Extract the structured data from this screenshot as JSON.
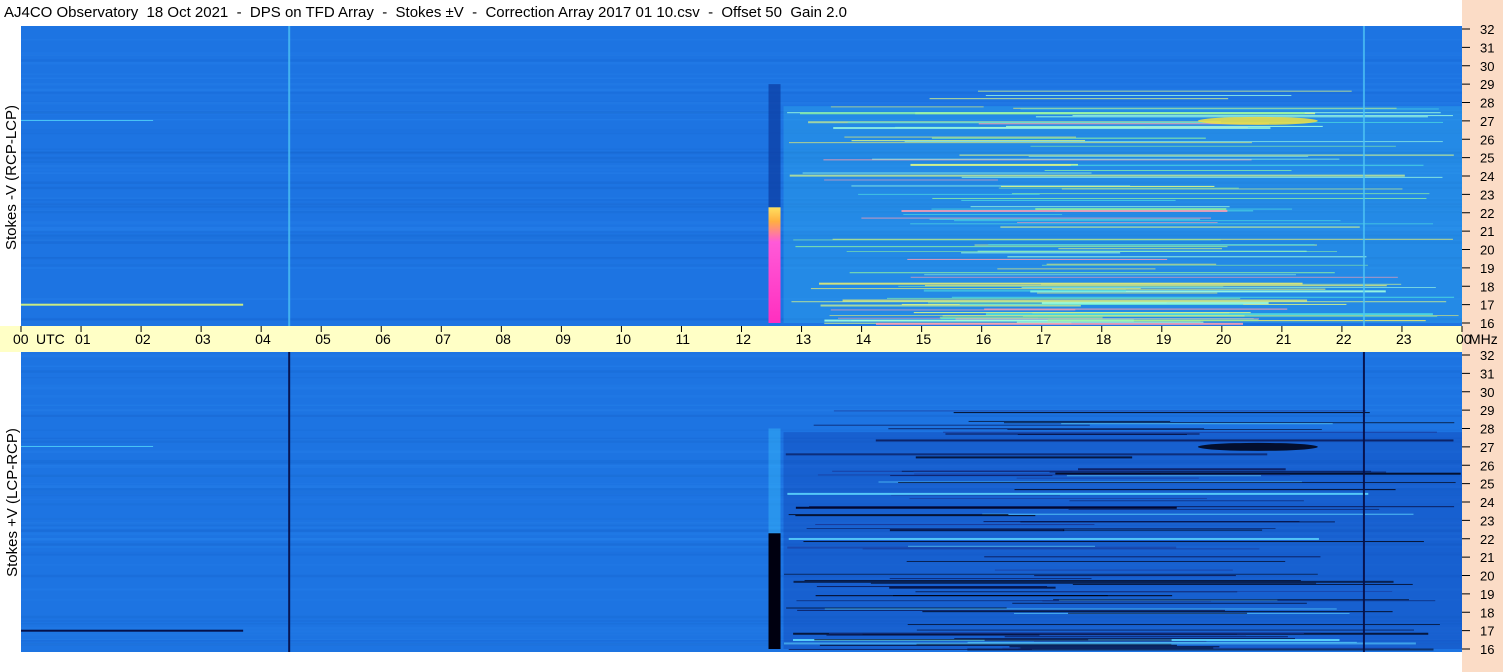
{
  "chart_data": [
    {
      "type": "heatmap",
      "title": "AJ4CO Observatory  18 Oct 2021  -  DPS on TFD Array  -  Stokes ±V  -  Correction Array 2017 01 10.csv  -  Offset 50  Gain 2.0",
      "ylabel": "Stokes -V (RCP-LCP)",
      "xlabel": "UTC",
      "x_ticks": [
        "00",
        "01",
        "02",
        "03",
        "04",
        "05",
        "06",
        "07",
        "08",
        "09",
        "10",
        "11",
        "12",
        "13",
        "14",
        "15",
        "16",
        "17",
        "18",
        "19",
        "20",
        "21",
        "22",
        "23",
        "00"
      ],
      "x_range_utc_hours": [
        0,
        24
      ],
      "y_unit": "MHz",
      "y_ticks": [
        16,
        17,
        18,
        19,
        20,
        21,
        22,
        23,
        24,
        25,
        26,
        27,
        28,
        29,
        30,
        31,
        32
      ],
      "y_range_mhz": [
        16,
        32
      ],
      "features": [
        {
          "desc": "bright burst",
          "utc_start": 12.45,
          "utc_end": 12.65,
          "mhz_range": [
            16,
            22.3
          ]
        },
        {
          "desc": "vertical line",
          "utc": 4.45
        },
        {
          "desc": "vertical line",
          "utc": 22.35
        }
      ],
      "colors": {
        "background": "#1d74e2",
        "high": "#ff3ad0",
        "mid": "#6cf2a0"
      }
    },
    {
      "type": "heatmap",
      "ylabel": "Stokes +V (LCP-RCP)",
      "xlabel": "UTC",
      "x_range_utc_hours": [
        0,
        24
      ],
      "y_unit": "MHz",
      "y_ticks": [
        16,
        17,
        18,
        19,
        20,
        21,
        22,
        23,
        24,
        25,
        26,
        27,
        28,
        29,
        30,
        31,
        32
      ],
      "y_range_mhz": [
        16,
        32
      ],
      "features": [
        {
          "desc": "dark burst",
          "utc_start": 12.45,
          "utc_end": 12.65,
          "mhz_range": [
            16,
            22.3
          ]
        },
        {
          "desc": "vertical line",
          "utc": 4.45
        },
        {
          "desc": "vertical line",
          "utc": 22.35
        }
      ],
      "colors": {
        "background": "#1d74e2",
        "low": "#000010"
      }
    }
  ],
  "time_axis": {
    "labels": [
      "00",
      "01",
      "02",
      "03",
      "04",
      "05",
      "06",
      "07",
      "08",
      "09",
      "10",
      "11",
      "12",
      "13",
      "14",
      "15",
      "16",
      "17",
      "18",
      "19",
      "20",
      "21",
      "22",
      "23",
      "00"
    ],
    "utc_label": "UTC",
    "mhz_label": "MHz"
  },
  "ylabels": {
    "top": "Stokes -V (RCP-LCP)",
    "bottom": "Stokes +V (LCP-RCP)"
  },
  "title": "AJ4CO Observatory  18 Oct 2021  -  DPS on TFD Array  -  Stokes ±V  -  Correction Array 2017 01 10.csv  -  Offset 50  Gain 2.0"
}
